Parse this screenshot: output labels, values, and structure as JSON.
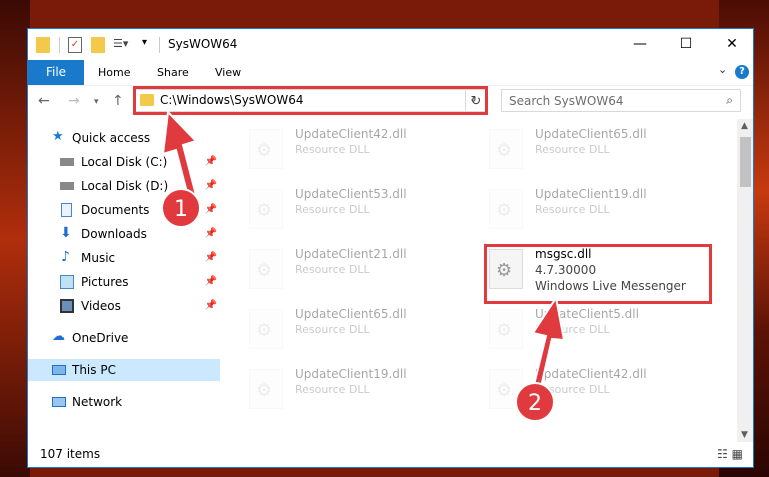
{
  "window": {
    "title": "SysWOW64",
    "controls": {
      "minimize": "—",
      "maximize": "☐",
      "close": "✕"
    }
  },
  "ribbon": {
    "tabs": [
      "File",
      "Home",
      "Share",
      "View"
    ],
    "expand": "⌄",
    "help": "?"
  },
  "nav": {
    "address": "C:\\Windows\\SysWOW64",
    "search_placeholder": "Search SysWOW64"
  },
  "sidebar": {
    "items": [
      {
        "label": "Quick access",
        "icon": "star-icon",
        "pinned": false
      },
      {
        "label": "Local Disk (C:)",
        "icon": "drive-icon",
        "pinned": true
      },
      {
        "label": "Local Disk (D:)",
        "icon": "drive-icon",
        "pinned": true
      },
      {
        "label": "Documents",
        "icon": "documents-icon",
        "pinned": true
      },
      {
        "label": "Downloads",
        "icon": "download-icon",
        "pinned": true
      },
      {
        "label": "Music",
        "icon": "music-icon",
        "pinned": true
      },
      {
        "label": "Pictures",
        "icon": "pictures-icon",
        "pinned": true
      },
      {
        "label": "Videos",
        "icon": "videos-icon",
        "pinned": true
      },
      {
        "label": "OneDrive",
        "icon": "cloud-icon",
        "pinned": false
      },
      {
        "label": "This PC",
        "icon": "computer-icon",
        "pinned": false
      },
      {
        "label": "Network",
        "icon": "network-icon",
        "pinned": false
      }
    ]
  },
  "files": [
    {
      "name": "UpdateClient42.dll",
      "desc": "Resource DLL"
    },
    {
      "name": "UpdateClient65.dll",
      "desc": "Resource DLL"
    },
    {
      "name": "UpdateClient53.dll",
      "desc": "Resource DLL"
    },
    {
      "name": "UpdateClient19.dll",
      "desc": "Resource DLL"
    },
    {
      "name": "UpdateClient21.dll",
      "desc": "Resource DLL"
    },
    {
      "name": "msgsc.dll",
      "version": "4.7.30000",
      "desc": "Windows Live Messenger"
    },
    {
      "name": "UpdateClient65.dll",
      "desc": "Resource DLL"
    },
    {
      "name": "UpdateClient5.dll",
      "desc": "Resource DLL"
    },
    {
      "name": "UpdateClient19.dll",
      "desc": "Resource DLL"
    },
    {
      "name": "UpdateClient42.dll",
      "desc": "Resource DLL"
    }
  ],
  "status": {
    "count": "107 items"
  },
  "annotations": {
    "badge1": "1",
    "badge2": "2"
  },
  "colors": {
    "accent": "#1979ca",
    "highlight": "#e0393e",
    "selected": "#cce8ff"
  }
}
